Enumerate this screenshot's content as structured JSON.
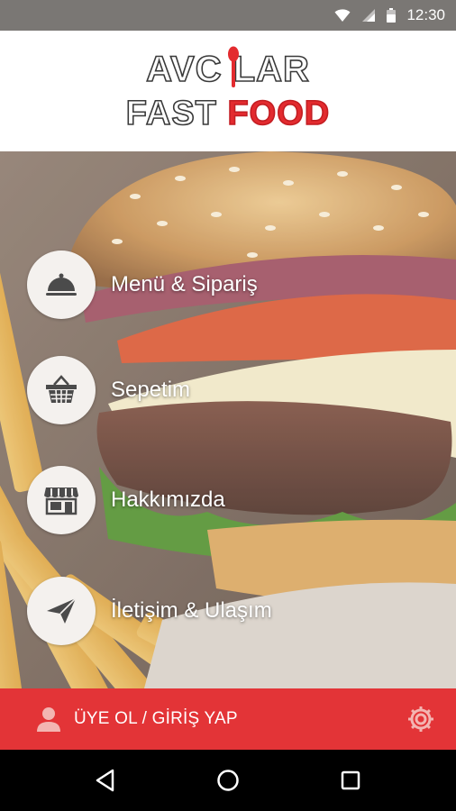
{
  "status_bar": {
    "time": "12:30"
  },
  "header": {
    "logo_line1": "AVC LAR",
    "logo_line2_black": "FAST ",
    "logo_line2_red": "FOOD"
  },
  "menu": {
    "items": [
      {
        "label": "Menü & Sipariş",
        "icon": "cloche-icon"
      },
      {
        "label": "Sepetim",
        "icon": "basket-icon"
      },
      {
        "label": "Hakkımızda",
        "icon": "store-icon"
      },
      {
        "label": "İletişim & Ulaşım",
        "icon": "paper-plane-icon"
      }
    ]
  },
  "bottom_bar": {
    "login_label": "ÜYE OL / GİRİŞ YAP",
    "background_color": "#e33437"
  }
}
